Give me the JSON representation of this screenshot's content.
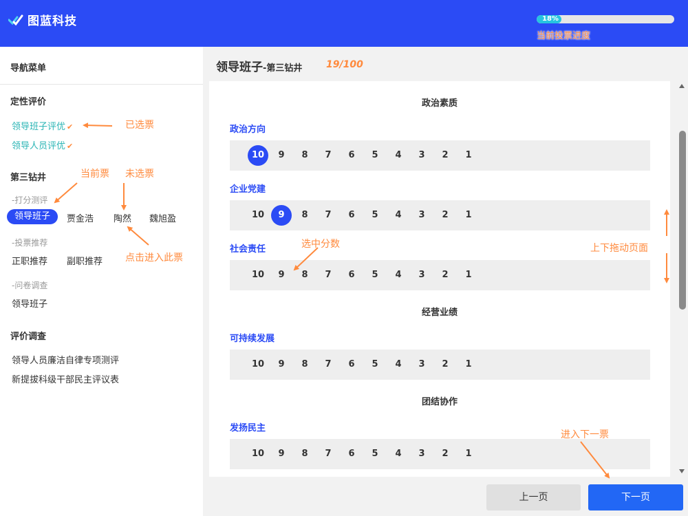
{
  "header": {
    "logo_text": "图蓝科技",
    "progress_percent": 18,
    "progress_text": "18%",
    "progress_label": "当前投票进度",
    "brand_color": "#2b4bf5"
  },
  "sidebar": {
    "title": "导航菜单",
    "sections": [
      {
        "title": "定性评价",
        "items": [
          {
            "label": "领导班子评优",
            "check": "✔"
          },
          {
            "label": "领导人员评优",
            "check": "✔"
          }
        ]
      },
      {
        "title": "第三钻井",
        "groups": [
          {
            "sub": "-打分测评",
            "items": [
              "领导班子",
              "贾金浩",
              "陶然",
              "魏旭盈"
            ]
          },
          {
            "sub": "-投票推荐",
            "items": [
              "正职推荐",
              "副职推荐"
            ]
          },
          {
            "sub": "-问卷调查",
            "items": [
              "领导班子"
            ]
          }
        ]
      },
      {
        "title": "评价调查",
        "items": [
          "领导人员廉洁自律专项测评",
          "新提拔科级干部民主评议表"
        ]
      }
    ]
  },
  "annotations": {
    "selected_vote": "已选票",
    "current_vote": "当前票",
    "unselected_vote": "未选票",
    "click_enter": "点击进入此票",
    "selected_score": "选中分数",
    "drag_page": "上下拖动页面",
    "next_vote": "进入下一票"
  },
  "main": {
    "title": "领导班子",
    "subtitle": "-第三钻井",
    "count": "19/100",
    "scores": [
      "10",
      "9",
      "8",
      "7",
      "6",
      "5",
      "4",
      "3",
      "2",
      "1"
    ],
    "groups": [
      {
        "title": "政治素质",
        "questions": [
          {
            "label": "政治方向",
            "selected": "10"
          },
          {
            "label": "企业党建",
            "selected": "9"
          },
          {
            "label": "社会责任",
            "selected": ""
          }
        ]
      },
      {
        "title": "经营业绩",
        "questions": [
          {
            "label": "可持续发展",
            "selected": ""
          }
        ]
      },
      {
        "title": "团结协作",
        "questions": [
          {
            "label": "发扬民主",
            "selected": ""
          }
        ]
      }
    ]
  },
  "footer": {
    "prev_label": "上一页",
    "next_label": "下一页"
  }
}
